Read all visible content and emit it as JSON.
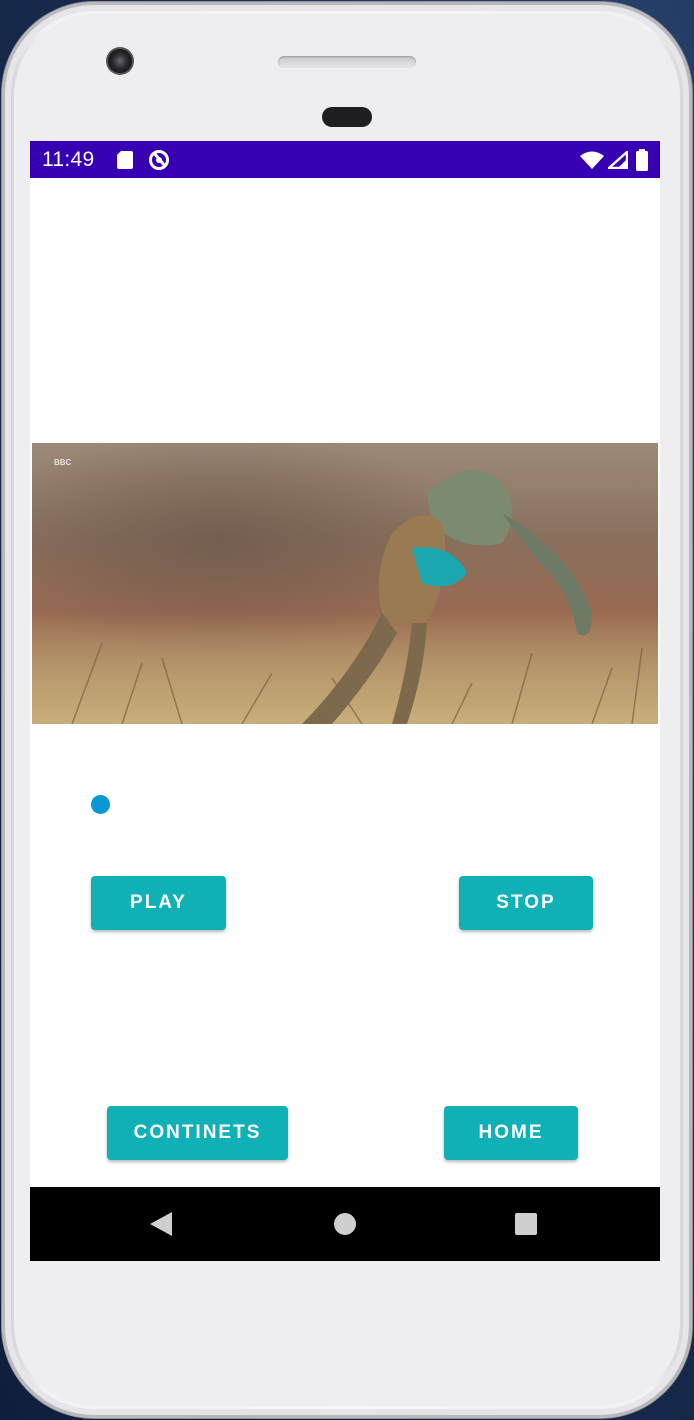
{
  "status_bar": {
    "time": "11:49",
    "background_color": "#3700b3",
    "left_icons": [
      "sd-card-icon",
      "sync-disabled-icon"
    ],
    "right_icons": [
      "wifi-icon",
      "cellular-signal-icon",
      "battery-icon"
    ]
  },
  "video": {
    "description_icon": "video-frame",
    "watermark": "BBC"
  },
  "seekbar": {
    "progress": 0,
    "thumb_color": "#0a97d4"
  },
  "buttons": {
    "play": "PLAY",
    "stop": "STOP",
    "continents": "CONTINETS",
    "home": "HOME",
    "color": "#0fb1b6"
  },
  "nav_bar": {
    "icons": [
      "back-icon",
      "home-icon",
      "recents-icon"
    ]
  }
}
